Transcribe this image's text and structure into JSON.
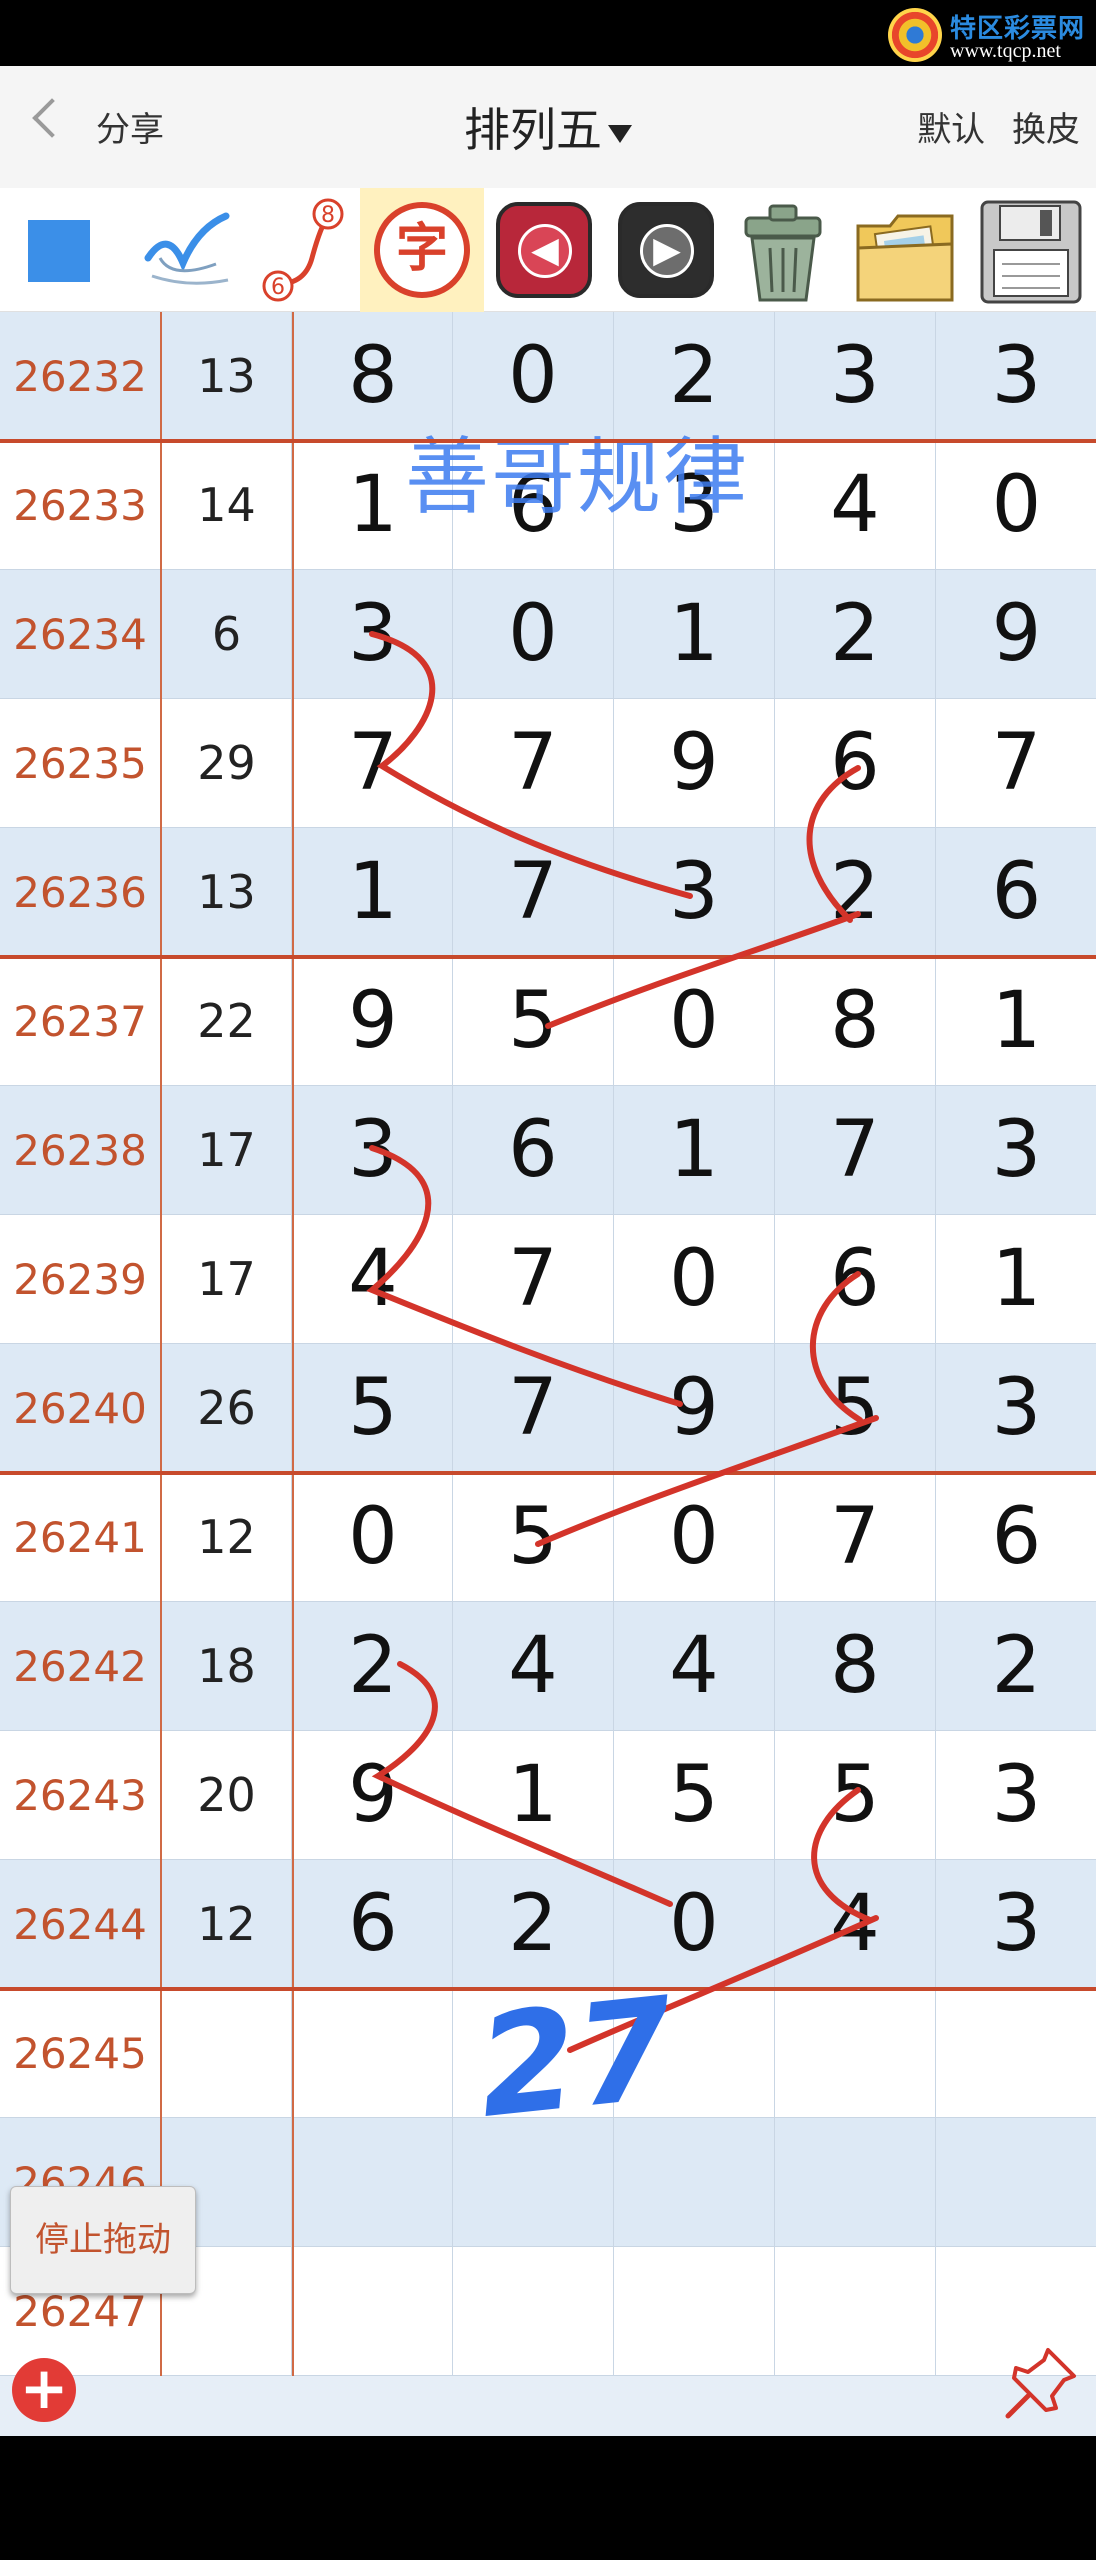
{
  "watermark": {
    "title": "特区彩票网",
    "url": "www.tqcp.net"
  },
  "header": {
    "share_label": "分享",
    "title": "排列五",
    "default_label": "默认",
    "skin_label": "换皮"
  },
  "toolbar": {
    "curve_top": "8",
    "curve_bottom": "6",
    "zi_label": "字"
  },
  "annotation": {
    "title": "善哥规律",
    "hand_number": "27"
  },
  "rows": [
    {
      "issue": "26232",
      "sum": "13",
      "d": [
        "8",
        "0",
        "2",
        "3",
        "3"
      ]
    },
    {
      "issue": "26233",
      "sum": "14",
      "d": [
        "1",
        "6",
        "3",
        "4",
        "0"
      ]
    },
    {
      "issue": "26234",
      "sum": "6",
      "d": [
        "3",
        "0",
        "1",
        "2",
        "9"
      ]
    },
    {
      "issue": "26235",
      "sum": "29",
      "d": [
        "7",
        "7",
        "9",
        "6",
        "7"
      ]
    },
    {
      "issue": "26236",
      "sum": "13",
      "d": [
        "1",
        "7",
        "3",
        "2",
        "6"
      ]
    },
    {
      "issue": "26237",
      "sum": "22",
      "d": [
        "9",
        "5",
        "0",
        "8",
        "1"
      ]
    },
    {
      "issue": "26238",
      "sum": "17",
      "d": [
        "3",
        "6",
        "1",
        "7",
        "3"
      ]
    },
    {
      "issue": "26239",
      "sum": "17",
      "d": [
        "4",
        "7",
        "0",
        "6",
        "1"
      ]
    },
    {
      "issue": "26240",
      "sum": "26",
      "d": [
        "5",
        "7",
        "9",
        "5",
        "3"
      ]
    },
    {
      "issue": "26241",
      "sum": "12",
      "d": [
        "0",
        "5",
        "0",
        "7",
        "6"
      ]
    },
    {
      "issue": "26242",
      "sum": "18",
      "d": [
        "2",
        "4",
        "4",
        "8",
        "2"
      ]
    },
    {
      "issue": "26243",
      "sum": "20",
      "d": [
        "9",
        "1",
        "5",
        "5",
        "3"
      ]
    },
    {
      "issue": "26244",
      "sum": "12",
      "d": [
        "6",
        "2",
        "0",
        "4",
        "3"
      ]
    },
    {
      "issue": "26245",
      "sum": "",
      "d": [
        "",
        "",
        "",
        "",
        ""
      ]
    },
    {
      "issue": "26246",
      "sum": "",
      "d": [
        "",
        "",
        "",
        "",
        ""
      ]
    },
    {
      "issue": "26247",
      "sum": "",
      "d": [
        "",
        "",
        "",
        "",
        ""
      ]
    }
  ],
  "stop_drag_label": "停止拖动",
  "add_label": "+"
}
